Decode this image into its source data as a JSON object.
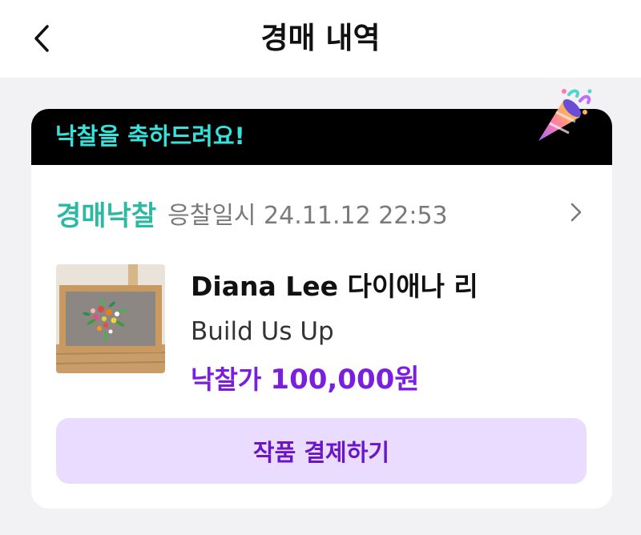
{
  "header": {
    "title": "경매 내역",
    "back_icon": "chevron-left-icon"
  },
  "banner": {
    "text": "낙찰을 축하드려요!",
    "icon": "party-popper-icon"
  },
  "auction": {
    "status": "경매낙찰",
    "bid_datetime": "응찰일시 24.11.12 22:53",
    "artist": "Diana Lee 다이애나 리",
    "artwork_title": "Build Us Up",
    "price_label": "낙찰가",
    "price_value": "100,000원",
    "pay_button_label": "작품 결제하기"
  },
  "colors": {
    "status_green": "#2bb9a4",
    "banner_cyan": "#33e3dc",
    "accent_purple": "#7a1fe0",
    "button_bg": "#eadcff"
  }
}
